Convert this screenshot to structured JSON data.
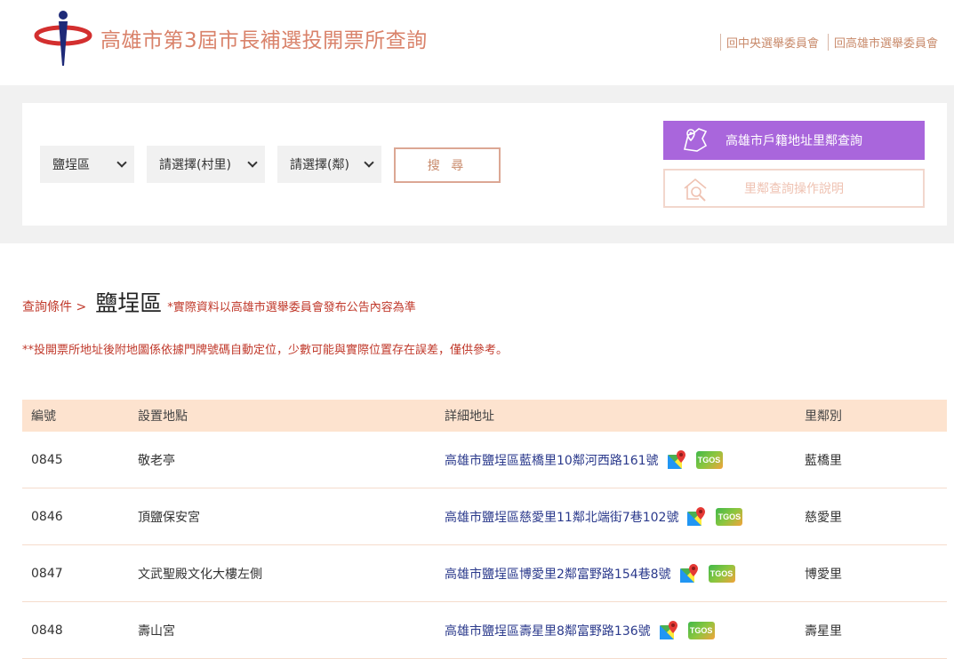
{
  "header": {
    "title": "高雄市第3屆市長補選投開票所查詢",
    "links": [
      "回中央選舉委員會",
      "回高雄市選舉委員會"
    ]
  },
  "search": {
    "district_value": "鹽埕區",
    "village_value": "請選擇(村里)",
    "neighbor_value": "請選擇(鄰)",
    "search_label": "搜 尋",
    "address_query_label": "高雄市戶籍地址里鄰查詢",
    "guide_label": "里鄰查詢操作說明"
  },
  "condition": {
    "label": "查詢條件 >",
    "district": "鹽埕區",
    "note": "*實際資料以高雄市選舉委員會發布公告內容為準",
    "disclaimer": "**投開票所地址後附地圖係依據門牌號碼自動定位，少數可能與實際位置存在誤差，僅供參考。"
  },
  "table": {
    "headers": [
      "編號",
      "設置地點",
      "詳細地址",
      "里鄰別"
    ],
    "rows": [
      {
        "id": "0845",
        "place": "敬老亭",
        "address": "高雄市鹽埕區藍橋里10鄰河西路161號",
        "village": "藍橋里"
      },
      {
        "id": "0846",
        "place": "頂鹽保安宮",
        "address": "高雄市鹽埕區慈愛里11鄰北端街7巷102號",
        "village": "慈愛里"
      },
      {
        "id": "0847",
        "place": "文武聖殿文化大樓左側",
        "address": "高雄市鹽埕區博愛里2鄰富野路154巷8號",
        "village": "博愛里"
      },
      {
        "id": "0848",
        "place": "壽山宮",
        "address": "高雄市鹽埕區壽星里8鄰富野路136號",
        "village": "壽星里"
      }
    ]
  },
  "icons": {
    "tgos_label": "TGOS"
  }
}
